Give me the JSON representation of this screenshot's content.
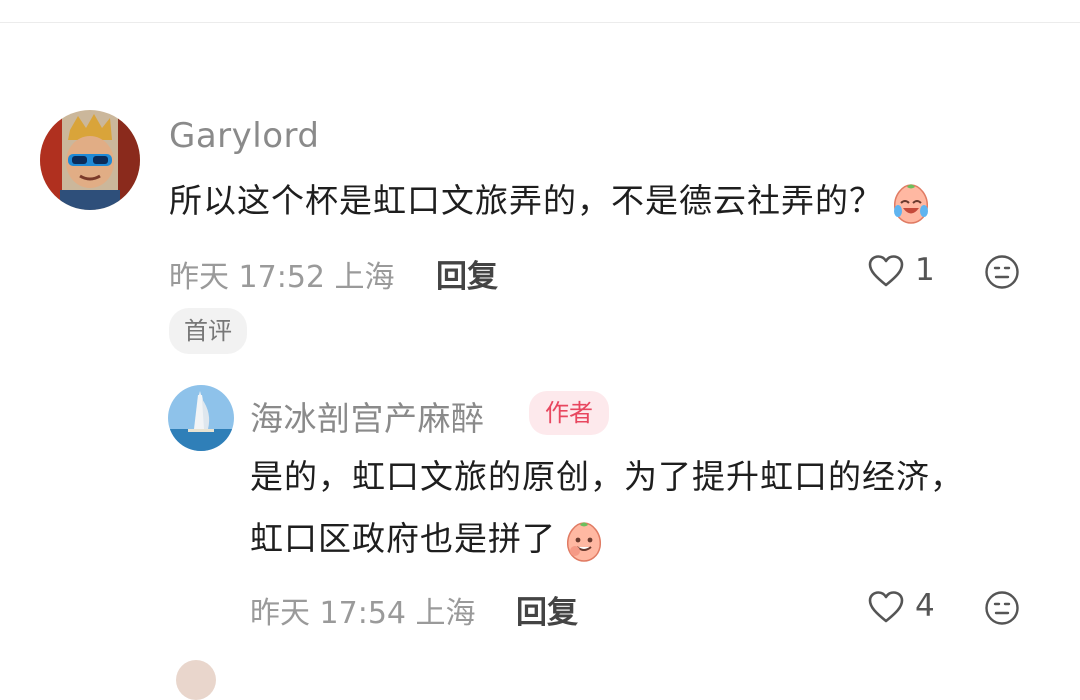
{
  "comment1": {
    "username": "Garylord",
    "text": "所以这个杯是虹口文旅弄的，不是德云社弄的？",
    "emoji": "crying-laughing-peach-emoji",
    "time": "昨天 17:52",
    "location": "上海",
    "reply_label": "回复",
    "likes": "1",
    "tag": "首评"
  },
  "comment2": {
    "username": "海冰剖宫产麻醉",
    "badge": "作者",
    "text": "是的，虹口文旅的原创，为了提升虹口的经济，虹口区政府也是拼了",
    "emoji": "grinning-peach-emoji",
    "time": "昨天 17:54",
    "location": "上海",
    "reply_label": "回复",
    "likes": "4"
  },
  "colors": {
    "author_badge_bg": "#fde9ec",
    "author_badge_text": "#e8475f",
    "meta": "#9a9a9a"
  }
}
